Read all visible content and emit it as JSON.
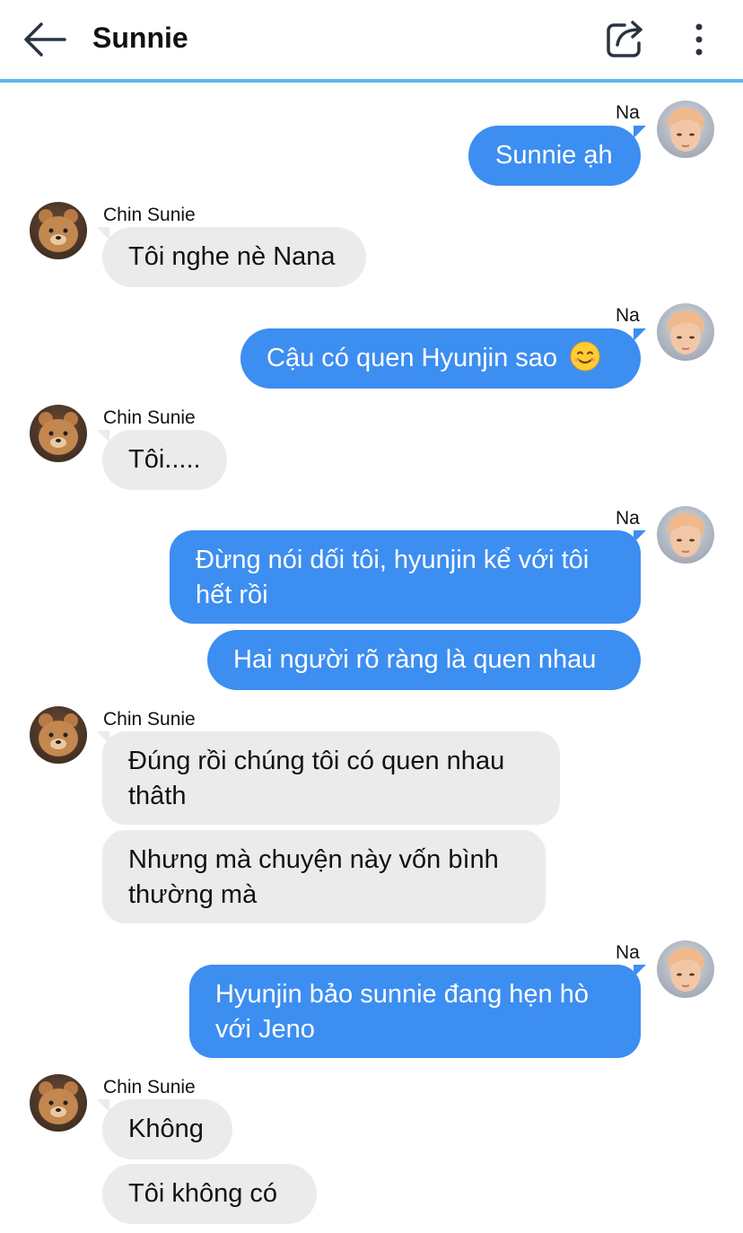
{
  "header": {
    "title": "Sunnie"
  },
  "participants": {
    "me": "Na",
    "other": "Chin Sunie"
  },
  "messages": [
    {
      "text": "Sunnie ạh"
    },
    {
      "text": "Tôi nghe nè Nana"
    },
    {
      "text": "Cậu có quen Hyunjin sao"
    },
    {
      "text": "Tôi....."
    },
    {
      "line1": "Đừng nói dối tôi, hyunjin kể với tôi",
      "line2": "hết rồi"
    },
    {
      "text": "Hai người rõ ràng là quen nhau"
    },
    {
      "line1": "Đúng rồi chúng tôi có quen nhau",
      "line2": "thâth"
    },
    {
      "line1": "Nhưng mà chuyện này vốn bình",
      "line2": "thường mà"
    },
    {
      "line1": "Hyunjin bảo sunnie đang hẹn hò",
      "line2": "với Jeno"
    },
    {
      "text": "Không"
    },
    {
      "text": "Tôi không có"
    }
  ],
  "colors": {
    "outgoing": "#3d8ef1",
    "incoming": "#ebebeb",
    "header_line": "#5bb8ec"
  },
  "icons": [
    "back-arrow-icon",
    "share-icon",
    "more-vertical-icon",
    "smiley-emoji"
  ]
}
